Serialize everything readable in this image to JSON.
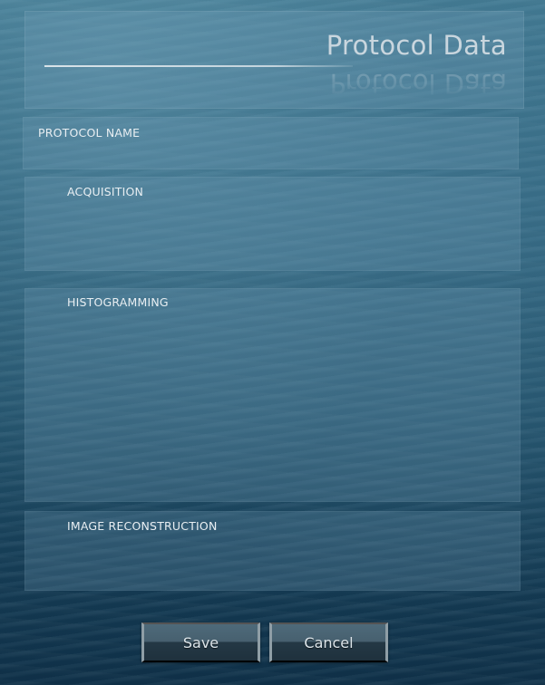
{
  "header": {
    "title": "Protocol Data"
  },
  "panels": {
    "protocol_name": {
      "label": "PROTOCOL NAME"
    },
    "acquisition": {
      "label": "ACQUISITION"
    },
    "histogramming": {
      "label": "HISTOGRAMMING"
    },
    "image_reconstruction": {
      "label": "IMAGE RECONSTRUCTION"
    }
  },
  "buttons": {
    "save_label": "Save",
    "cancel_label": "Cancel"
  }
}
